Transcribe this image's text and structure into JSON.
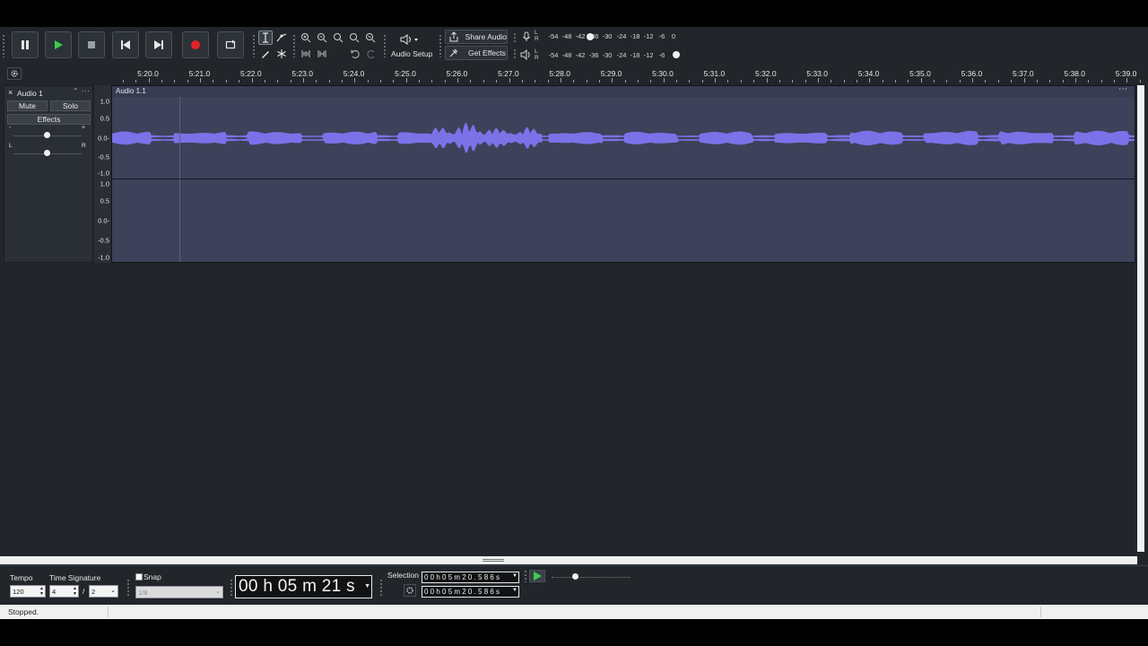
{
  "toolbar": {
    "audio_setup_label": "Audio Setup",
    "share_audio_label": "Share Audio",
    "get_effects_label": "Get Effects",
    "meter_scale": [
      "-54",
      "-48",
      "-42",
      "-36",
      "-30",
      "-24",
      "-18",
      "-12",
      "-6",
      "0"
    ],
    "meter_scale_play": [
      "-54",
      "-48",
      "-42",
      "-36",
      "-30",
      "-24",
      "-18",
      "-12",
      "-6"
    ],
    "meter_lr": [
      "L",
      "R"
    ]
  },
  "ruler": {
    "labels": [
      "5:20.0",
      "5:21.0",
      "5:22.0",
      "5:23.0",
      "5:24.0",
      "5:25.0",
      "5:26.0",
      "5:27.0",
      "5:28.0",
      "5:29.0",
      "5:30.0",
      "5:31.0",
      "5:32.0",
      "5:33.0",
      "5:34.0",
      "5:35.0",
      "5:36.0",
      "5:37.0",
      "5:38.0",
      "5:39.0"
    ]
  },
  "track": {
    "name": "Audio 1",
    "mute_label": "Mute",
    "solo_label": "Solo",
    "effects_label": "Effects",
    "gain_minus": "-",
    "gain_plus": "+",
    "pan_left": "L",
    "pan_right": "R",
    "clip_name": "Audio 1.1",
    "scale_labels": [
      "1.0",
      "0.5",
      "0.0-",
      "-0.5",
      "-1.0"
    ],
    "waveform_color": "#7b72e8"
  },
  "bottom": {
    "tempo_label": "Tempo",
    "tempo_value": "120",
    "time_signature_label": "Time Signature",
    "ts_numerator": "4",
    "ts_separator": "/",
    "ts_denominator": "2",
    "snap_label": "Snap",
    "snap_value": "1/8",
    "time_display": "00 h 05 m 21 s",
    "selection_label": "Selection",
    "selection_start": "0 0 h 0 5 m 2 0 . 5 8 6 s",
    "selection_end": "0 0 h 0 5 m 2 0 . 5 8 6 s"
  },
  "status": {
    "text": "Stopped."
  }
}
